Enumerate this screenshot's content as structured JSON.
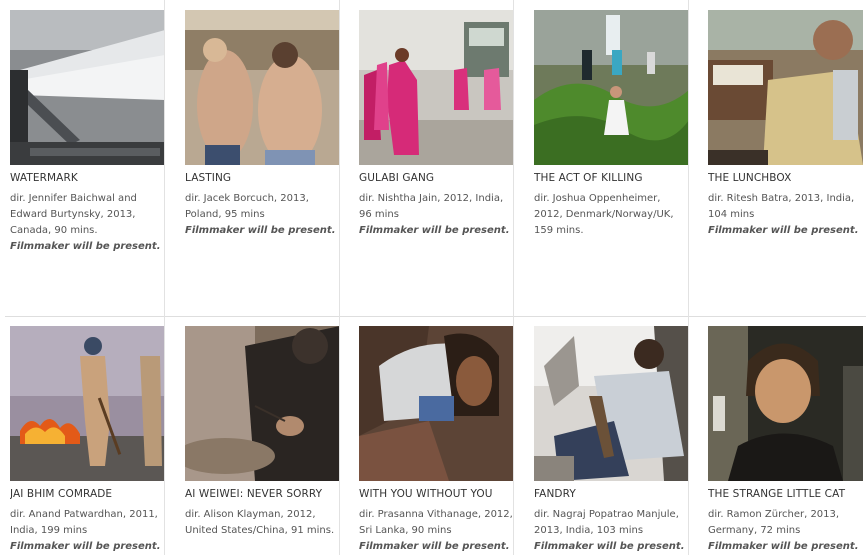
{
  "films": [
    {
      "title": "WATERMARK",
      "credit": "dir. Jennifer Baichwal and Edward Burtynsky, 2013, Canada, 90 mins.",
      "note": "Filmmaker will be present."
    },
    {
      "title": "LASTING",
      "credit": "dir. Jacek Borcuch, 2013, Poland, 95 mins",
      "note": "Filmmaker will be present."
    },
    {
      "title": "GULABI GANG",
      "credit": "dir. Nishtha Jain, 2012, India, 96 mins",
      "note": "Filmmaker will be present."
    },
    {
      "title": "THE ACT OF KILLING",
      "credit": "dir. Joshua Oppenheimer, 2012, Denmark/Norway/UK, 159 mins.",
      "note": ""
    },
    {
      "title": "THE LUNCHBOX",
      "credit": "dir. Ritesh Batra, 2013, India, 104 mins",
      "note": "Filmmaker will be present."
    },
    {
      "title": "JAI BHIM COMRADE",
      "credit": "dir. Anand Patwardhan, 2011, India, 199 mins",
      "note": "Filmmaker will be present."
    },
    {
      "title": "AI WEIWEI: NEVER SORRY",
      "credit": "dir. Alison Klayman, 2012, United States/China, 91 mins.",
      "note": ""
    },
    {
      "title": "WITH YOU WITHOUT YOU",
      "credit": "dir. Prasanna Vithanage, 2012, Sri Lanka, 90 mins",
      "note": "Filmmaker will be present."
    },
    {
      "title": "FANDRY",
      "credit": "dir. Nagraj Popatrao Manjule, 2013, India, 103 mins",
      "note": "Filmmaker will be present."
    },
    {
      "title": "THE STRANGE LITTLE CAT",
      "credit": "dir. Ramon Zürcher, 2013, Germany, 72 mins",
      "note": "Filmmaker will be present."
    }
  ]
}
